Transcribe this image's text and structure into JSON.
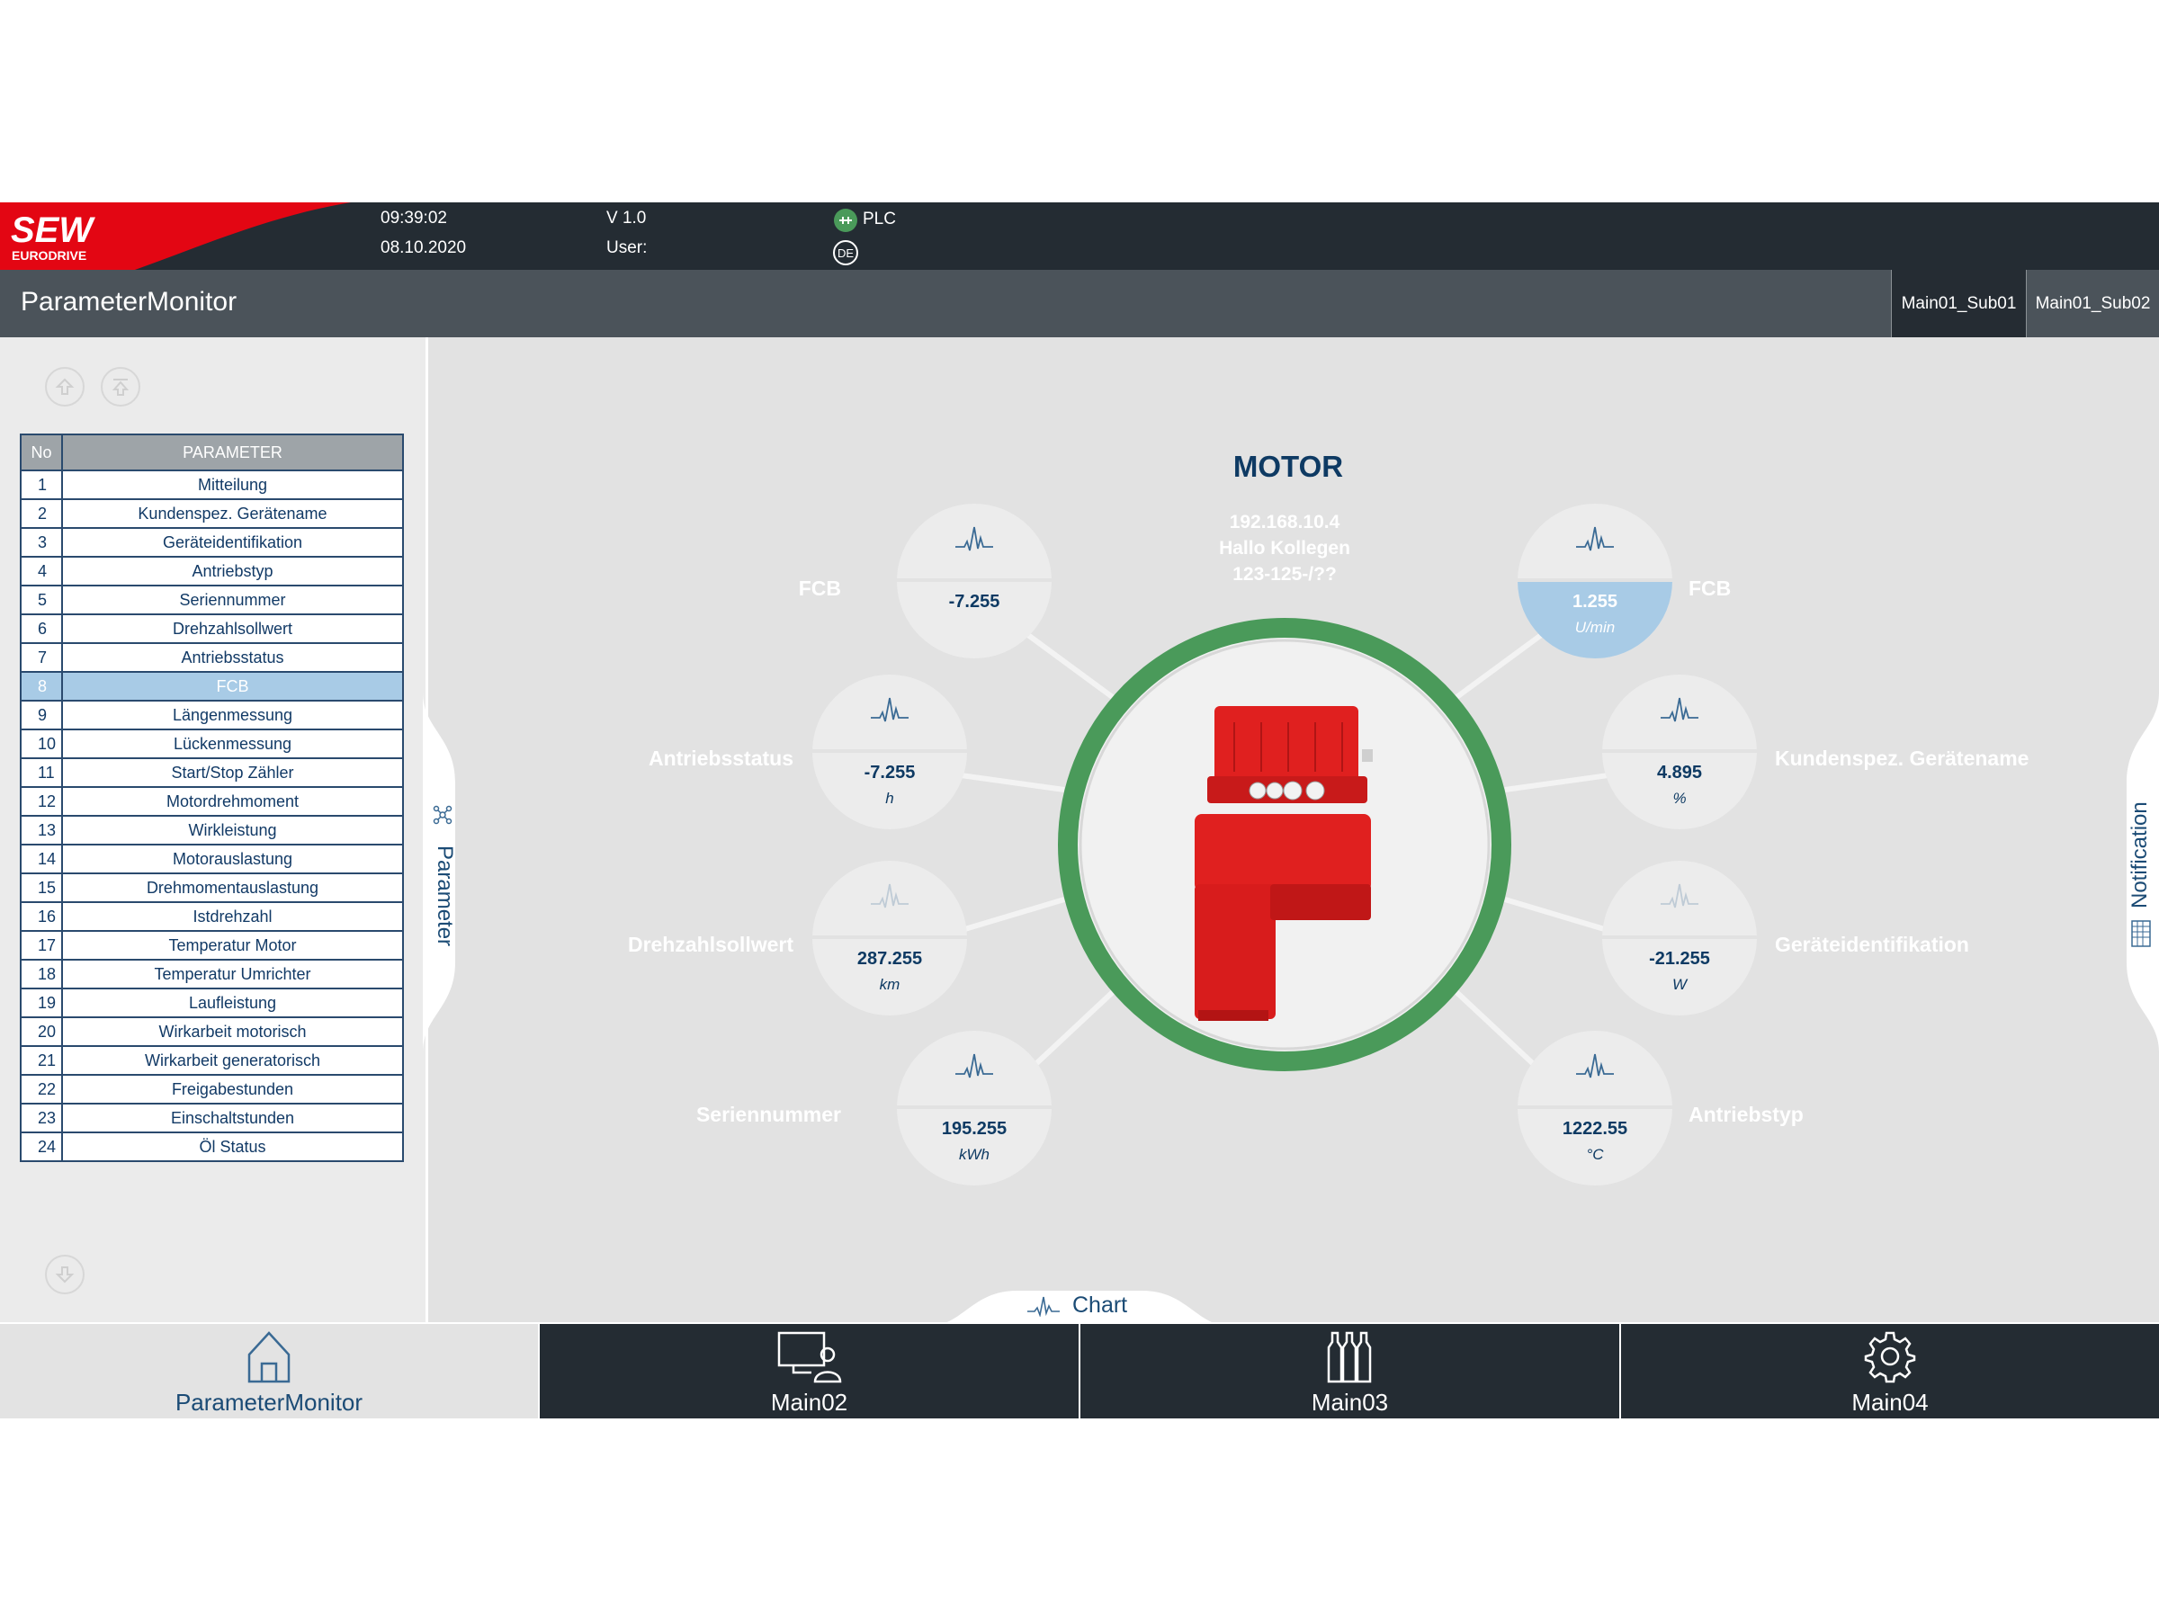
{
  "header": {
    "brand_line1": "SEW",
    "brand_line2": "EURODRIVE",
    "time": "09:39:02",
    "date": "08.10.2020",
    "version": "V 1.0",
    "user_label": "User:",
    "plc_label": "PLC",
    "language": "DE"
  },
  "titlebar": {
    "title": "ParameterMonitor",
    "subtabs": [
      "Main01_Sub01",
      "Main01_Sub02"
    ]
  },
  "table": {
    "headers": [
      "No",
      "PARAMETER"
    ],
    "rows": [
      {
        "no": "1",
        "name": "Mitteilung"
      },
      {
        "no": "2",
        "name": "Kundenspez. Gerätename"
      },
      {
        "no": "3",
        "name": "Geräteidentifikation"
      },
      {
        "no": "4",
        "name": "Antriebstyp"
      },
      {
        "no": "5",
        "name": "Seriennummer"
      },
      {
        "no": "6",
        "name": "Drehzahlsollwert"
      },
      {
        "no": "7",
        "name": "Antriebsstatus"
      },
      {
        "no": "8",
        "name": "FCB"
      },
      {
        "no": "9",
        "name": "Längenmessung"
      },
      {
        "no": "10",
        "name": "Lückenmessung"
      },
      {
        "no": "11",
        "name": "Start/Stop Zähler"
      },
      {
        "no": "12",
        "name": "Motordrehmoment"
      },
      {
        "no": "13",
        "name": "Wirkleistung"
      },
      {
        "no": "14",
        "name": "Motorauslastung"
      },
      {
        "no": "15",
        "name": "Drehmomentauslastung"
      },
      {
        "no": "16",
        "name": "Istdrehzahl"
      },
      {
        "no": "17",
        "name": "Temperatur Motor"
      },
      {
        "no": "18",
        "name": "Temperatur Umrichter"
      },
      {
        "no": "19",
        "name": "Laufleistung"
      },
      {
        "no": "20",
        "name": "Wirkarbeit motorisch"
      },
      {
        "no": "21",
        "name": "Wirkarbeit generatorisch"
      },
      {
        "no": "22",
        "name": "Freigabestunden"
      },
      {
        "no": "23",
        "name": "Einschaltstunden"
      },
      {
        "no": "24",
        "name": "Öl Status"
      }
    ],
    "selected_no": "8"
  },
  "side_tabs": {
    "left": "Parameter",
    "right": "Notification",
    "bottom": "Chart"
  },
  "motor": {
    "title": "MOTOR",
    "ip": "192.168.10.4",
    "line2": "Hallo Kollegen",
    "line3": "123-125-/??"
  },
  "gauges": [
    {
      "label": "FCB",
      "value": "-7.255",
      "unit": ""
    },
    {
      "label": "FCB",
      "value": "1.255",
      "unit": "U/min"
    },
    {
      "label": "Antriebsstatus",
      "value": "-7.255",
      "unit": "h"
    },
    {
      "label": "Kundenspez. Gerätename",
      "value": "4.895",
      "unit": "%"
    },
    {
      "label": "Drehzahlsollwert",
      "value": "287.255",
      "unit": "km"
    },
    {
      "label": "Geräteidentifikation",
      "value": "-21.255",
      "unit": "W"
    },
    {
      "label": "Seriennummer",
      "value": "195.255",
      "unit": "kWh"
    },
    {
      "label": "Antriebstyp",
      "value": "1222.55",
      "unit": "°C"
    }
  ],
  "bottom_nav": [
    "ParameterMonitor",
    "Main02",
    "Main03",
    "Main04"
  ],
  "colors": {
    "header_bg": "#242c33",
    "titlebar_bg": "#4b535a",
    "brand_red": "#e30613",
    "ring_green": "#4a9a5a",
    "highlight_blue": "#a8cbe6",
    "text_navy": "#0e3a63"
  },
  "icons": {
    "plc": "plc-connected-icon",
    "gauge": "waveform-icon",
    "home": "home-icon",
    "main02": "operator-station-icon",
    "main03": "bottles-icon",
    "main04": "gear-icon"
  }
}
